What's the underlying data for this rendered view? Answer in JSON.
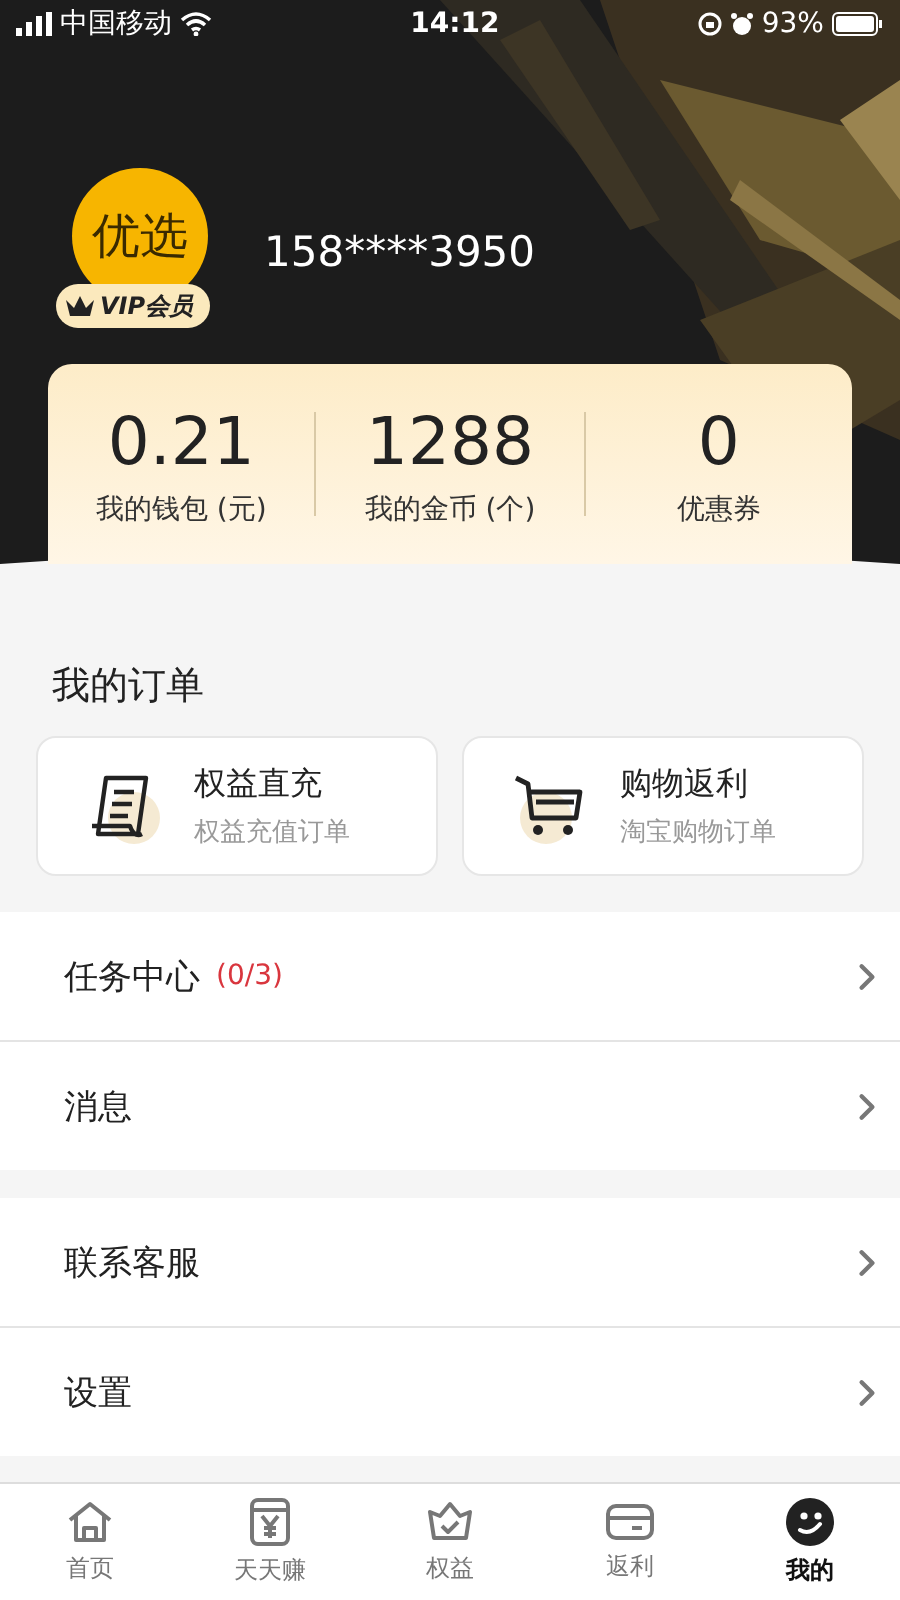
{
  "status_bar": {
    "carrier": "中国移动",
    "time": "14:12",
    "battery": "93%"
  },
  "profile": {
    "logo_text": "优选",
    "badge": "VIP会员",
    "phone": "158****3950"
  },
  "stats": [
    {
      "value": "0.21",
      "label": "我的钱包 (元)"
    },
    {
      "value": "1288",
      "label": "我的金币 (个)"
    },
    {
      "value": "0",
      "label": "优惠券"
    }
  ],
  "orders": {
    "title": "我的订单",
    "cards": [
      {
        "kind": "receipt",
        "title": "权益直充",
        "subtitle": "权益充值订单"
      },
      {
        "kind": "cart",
        "title": "购物返利",
        "subtitle": "淘宝购物订单"
      }
    ]
  },
  "menu_groups": [
    [
      {
        "label": "任务中心",
        "count": "(0/3)"
      },
      {
        "label": "消息"
      }
    ],
    [
      {
        "label": "联系客服"
      },
      {
        "label": "设置"
      }
    ]
  ],
  "tab_bar": [
    {
      "kind": "home",
      "label": "首页",
      "selected": false
    },
    {
      "kind": "earn",
      "label": "天天赚",
      "selected": false
    },
    {
      "kind": "shield",
      "label": "权益",
      "selected": false
    },
    {
      "kind": "card",
      "label": "返利",
      "selected": false
    },
    {
      "kind": "face",
      "label": "我的",
      "selected": true
    }
  ]
}
